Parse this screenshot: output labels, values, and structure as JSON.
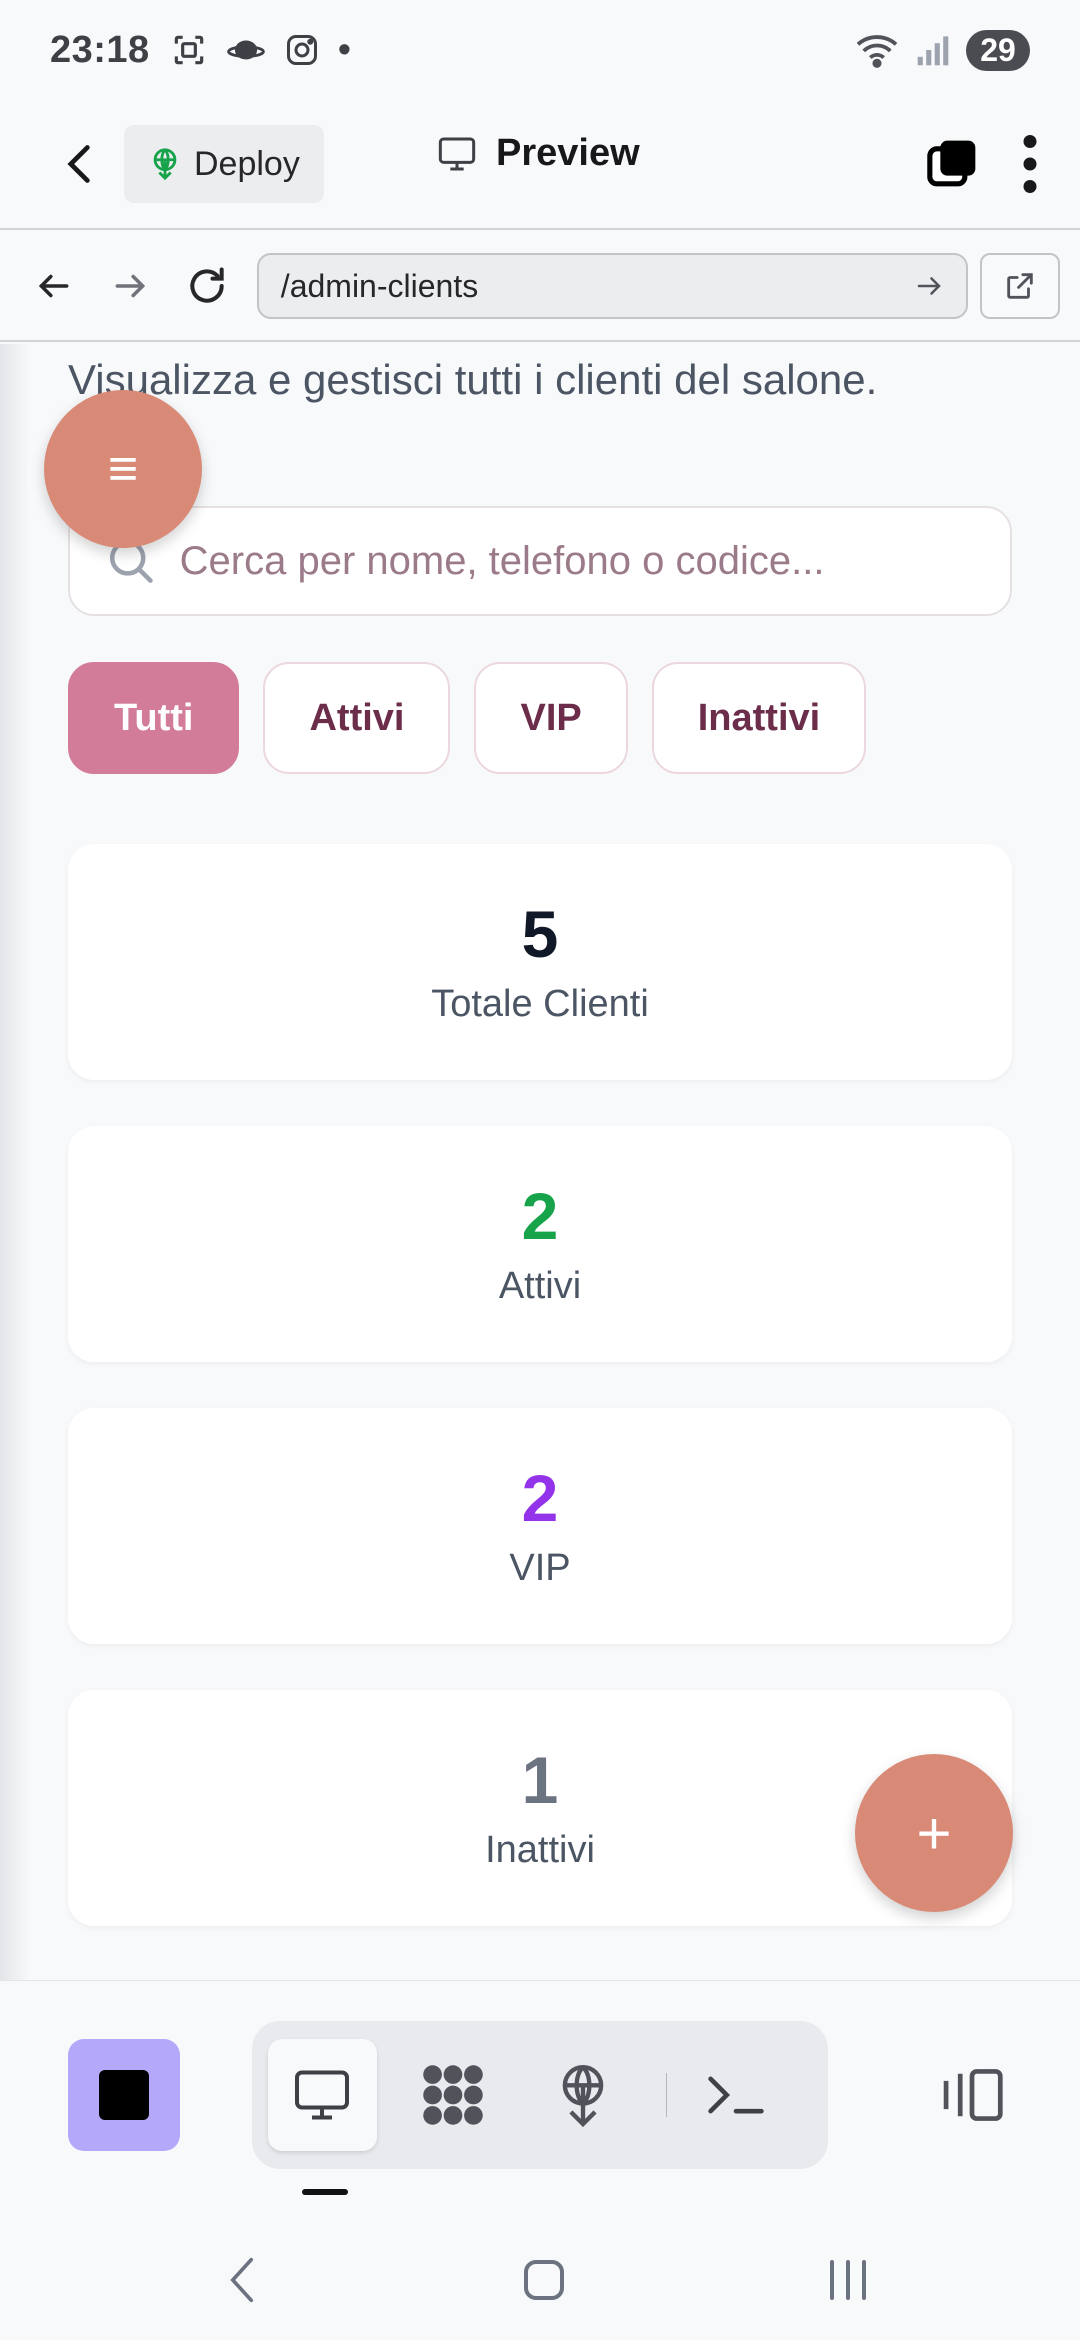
{
  "status_bar": {
    "time": "23:18",
    "dot": "•",
    "battery": "29",
    "icons": [
      "screenshot-icon",
      "saturn-icon",
      "instagram-icon",
      "wifi-icon",
      "signal-icon"
    ]
  },
  "header": {
    "deploy_label": "Deploy",
    "preview_label": "Preview"
  },
  "url_bar": {
    "url": "/admin-clients"
  },
  "page": {
    "subtitle": "Visualizza e gestisci tutti i clienti del salone.",
    "search_placeholder": "Cerca per nome, telefono o codice...",
    "filters": [
      "Tutti",
      "Attivi",
      "VIP",
      "Inattivi"
    ],
    "active_filter": "Tutti",
    "stats": [
      {
        "value": "5",
        "label": "Totale Clienti",
        "color": "#111827"
      },
      {
        "value": "2",
        "label": "Attivi",
        "color": "#16a34a"
      },
      {
        "value": "2",
        "label": "VIP",
        "color": "#9333ea"
      },
      {
        "value": "1",
        "label": "Inattivi",
        "color": "#6b7280"
      }
    ],
    "menu_fab": "≡",
    "add_fab": "+"
  },
  "colors": {
    "accent": "#d27c9a",
    "fab": "#d88a77",
    "stop": "#b4a8fb"
  }
}
